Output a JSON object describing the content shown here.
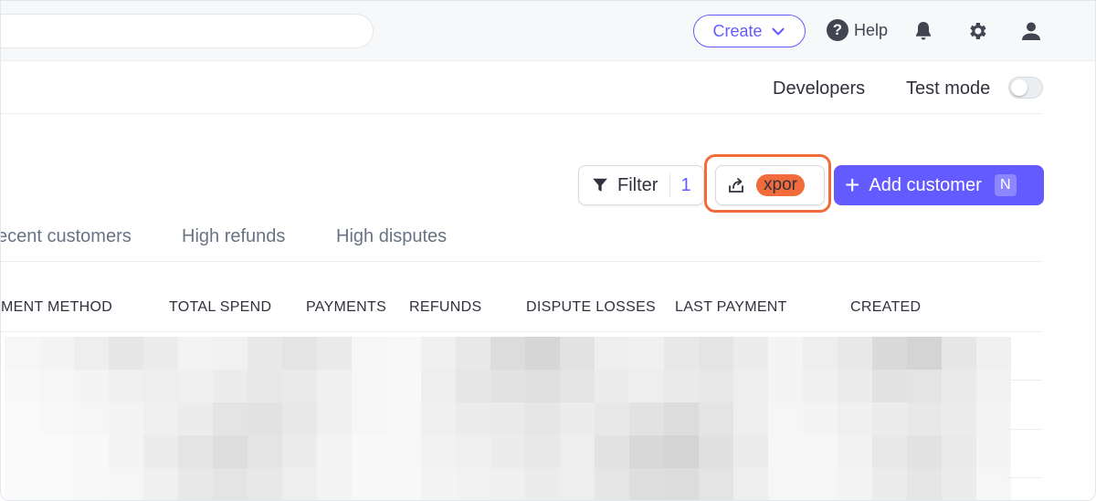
{
  "topbar": {
    "search_placeholder": "",
    "create_label": "Create",
    "help_label": "Help",
    "icons": [
      "question-icon",
      "bell-icon",
      "gear-icon",
      "user-icon"
    ]
  },
  "devbar": {
    "developers_label": "Developers",
    "test_mode_label": "Test mode",
    "test_mode_on": false
  },
  "actions": {
    "filter_label": "Filter",
    "filter_count": "1",
    "export_label": "xpor",
    "add_customer_label": "Add customer",
    "add_customer_shortcut": "N"
  },
  "tabs": [
    {
      "label": "ecent customers"
    },
    {
      "label": "High refunds"
    },
    {
      "label": "High disputes"
    }
  ],
  "table": {
    "columns": [
      "MENT METHOD",
      "TOTAL SPEND",
      "PAYMENTS",
      "REFUNDS",
      "DISPUTE LOSSES",
      "LAST PAYMENT",
      "CREATED"
    ]
  },
  "colors": {
    "accent": "#635bff",
    "highlight": "#f26b3a"
  }
}
